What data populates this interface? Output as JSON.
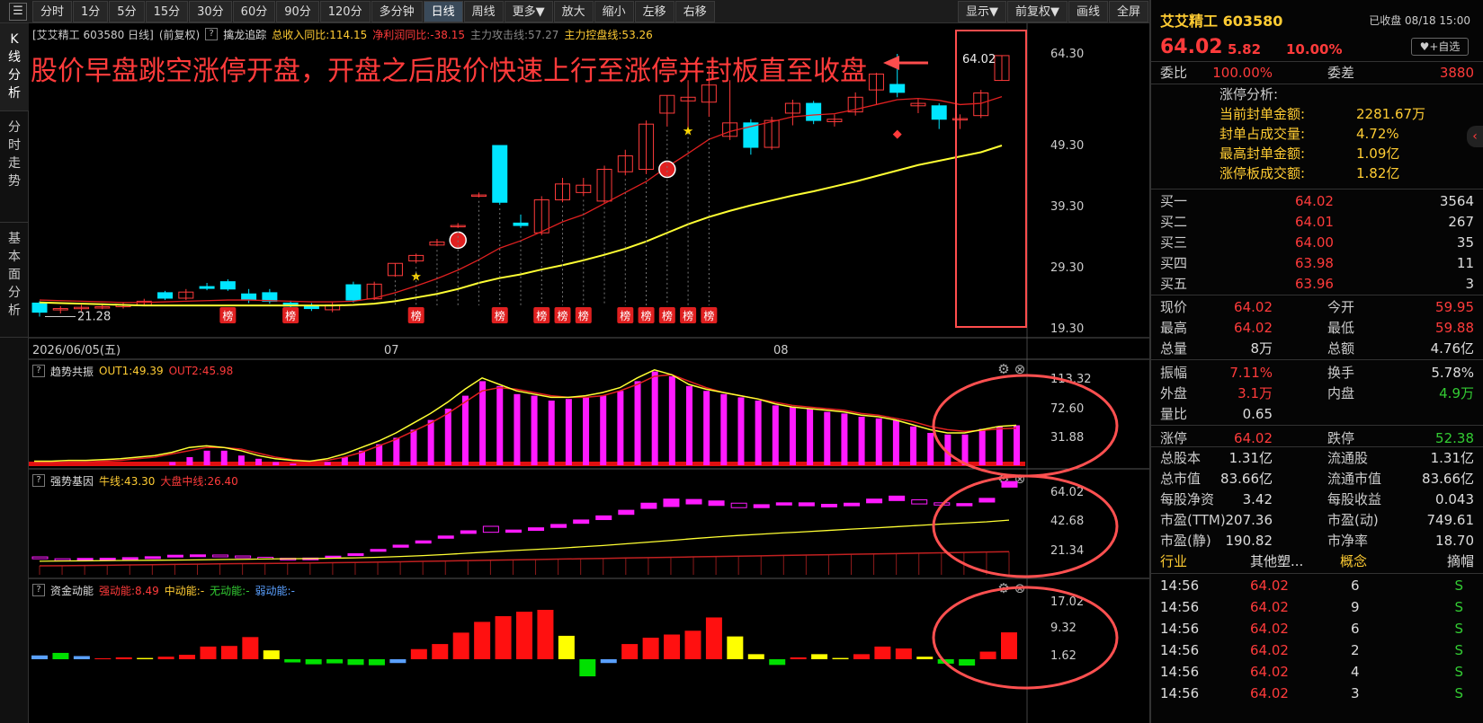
{
  "toolbar": {
    "items": [
      "分时",
      "1分",
      "5分",
      "15分",
      "30分",
      "60分",
      "90分",
      "120分",
      "多分钟",
      "日线",
      "周线",
      "更多▼",
      "放大",
      "缩小",
      "左移",
      "右移"
    ],
    "active": "日线",
    "right_items": [
      "显示▼",
      "前复权▼",
      "画线",
      "全屏"
    ]
  },
  "sidetabs": [
    "K线分析",
    "分时走势",
    "基本面分析"
  ],
  "main_info": {
    "name": "[艾艾精工 603580 日线]",
    "adjust": "(前复权)",
    "indicator": "擒龙追踪",
    "rev": "总收入同比:114.15",
    "profit": "净利润同比:-38.15",
    "attack": "主力攻击线:57.27",
    "control": "主力控盘线:53.26"
  },
  "annotation": "股价早盘跳空涨停开盘，开盘之后股价快速上行至涨停并封板直至收盘",
  "axis": {
    "main": [
      "64.30",
      "49.30",
      "39.30",
      "29.30",
      "19.30"
    ],
    "ind1": [
      "113.32",
      "72.60",
      "31.88"
    ],
    "ind2": [
      "64.02",
      "42.68",
      "21.34"
    ],
    "ind3": [
      "17.02",
      "9.32",
      "1.62"
    ],
    "dates": [
      "2026/06/05(五)",
      "07",
      "08"
    ],
    "low_label": "21.28",
    "last_label": "64.02"
  },
  "ind1": {
    "name": "趋势共振",
    "out1": "OUT1:49.39",
    "out2": "OUT2:45.98"
  },
  "ind2": {
    "name": "强势基因",
    "bull": "牛线:43.30",
    "market": "大盘中线:26.40"
  },
  "ind3": {
    "name": "资金动能",
    "strong": "强动能:8.49",
    "mid": "中动能:-",
    "none": "无动能:-",
    "weak": "弱动能:-"
  },
  "badge": "榜",
  "chart_data": {
    "type": "candlestick",
    "candles": [
      {
        "o": 23.5,
        "c": 22.0,
        "h": 23.8,
        "l": 21.28
      },
      {
        "o": 22.4,
        "c": 22.6,
        "h": 23.0,
        "l": 21.8
      },
      {
        "o": 22.6,
        "c": 22.8,
        "h": 23.2,
        "l": 22.2
      },
      {
        "o": 22.8,
        "c": 22.9,
        "h": 23.3,
        "l": 22.5
      },
      {
        "o": 22.9,
        "c": 23.2,
        "h": 23.6,
        "l": 22.6
      },
      {
        "o": 23.2,
        "c": 23.8,
        "h": 24.2,
        "l": 23.0
      },
      {
        "o": 25.2,
        "c": 24.3,
        "h": 25.5,
        "l": 24.0
      },
      {
        "o": 24.3,
        "c": 25.3,
        "h": 25.8,
        "l": 24.0
      },
      {
        "o": 26.2,
        "c": 25.9,
        "h": 26.8,
        "l": 25.6
      },
      {
        "o": 27.0,
        "c": 25.8,
        "h": 27.4,
        "l": 25.5
      },
      {
        "o": 25.0,
        "c": 24.0,
        "h": 25.8,
        "l": 23.5
      },
      {
        "o": 25.2,
        "c": 23.8,
        "h": 25.8,
        "l": 23.4
      },
      {
        "o": 23.5,
        "c": 23.0,
        "h": 23.9,
        "l": 22.6
      },
      {
        "o": 23.0,
        "c": 22.6,
        "h": 23.5,
        "l": 22.2
      },
      {
        "o": 22.4,
        "c": 23.2,
        "h": 23.6,
        "l": 22.0
      },
      {
        "o": 26.5,
        "c": 24.0,
        "h": 27.0,
        "l": 23.6
      },
      {
        "o": 24.2,
        "c": 26.6,
        "h": 27.0,
        "l": 24.0
      },
      {
        "o": 28.0,
        "c": 30.0,
        "h": 30.0,
        "l": 27.8
      },
      {
        "o": 30.4,
        "c": 31.3,
        "h": 31.6,
        "l": 30.0
      },
      {
        "o": 33.0,
        "c": 33.5,
        "h": 34.0,
        "l": 32.8
      },
      {
        "o": 36.0,
        "c": 36.2,
        "h": 36.6,
        "l": 35.8
      },
      {
        "o": 41.0,
        "c": 41.2,
        "h": 41.6,
        "l": 40.8
      },
      {
        "o": 49.3,
        "c": 40.0,
        "h": 49.3,
        "l": 39.6
      },
      {
        "o": 36.6,
        "c": 36.2,
        "h": 38.0,
        "l": 35.8
      },
      {
        "o": 35.0,
        "c": 40.4,
        "h": 41.0,
        "l": 34.6
      },
      {
        "o": 40.4,
        "c": 43.0,
        "h": 44.0,
        "l": 40.0
      },
      {
        "o": 41.6,
        "c": 42.8,
        "h": 44.0,
        "l": 41.0
      },
      {
        "o": 40.2,
        "c": 45.4,
        "h": 46.0,
        "l": 39.8
      },
      {
        "o": 45.0,
        "c": 47.6,
        "h": 48.6,
        "l": 44.4
      },
      {
        "o": 45.4,
        "c": 52.8,
        "h": 53.4,
        "l": 44.6
      },
      {
        "o": 54.6,
        "c": 57.5,
        "h": 57.5,
        "l": 52.4
      },
      {
        "o": 56.6,
        "c": 57.2,
        "h": 60.0,
        "l": 52.0
      },
      {
        "o": 56.4,
        "c": 59.2,
        "h": 62.0,
        "l": 54.0
      },
      {
        "o": 50.8,
        "c": 53.0,
        "h": 60.0,
        "l": 50.2
      },
      {
        "o": 53.0,
        "c": 49.0,
        "h": 53.6,
        "l": 47.8
      },
      {
        "o": 49.0,
        "c": 53.4,
        "h": 54.0,
        "l": 48.6
      },
      {
        "o": 54.6,
        "c": 56.2,
        "h": 56.8,
        "l": 52.6
      },
      {
        "o": 56.2,
        "c": 53.4,
        "h": 56.6,
        "l": 52.8
      },
      {
        "o": 53.2,
        "c": 53.6,
        "h": 54.4,
        "l": 52.4
      },
      {
        "o": 54.8,
        "c": 57.2,
        "h": 58.0,
        "l": 54.2
      },
      {
        "o": 58.4,
        "c": 61.0,
        "h": 61.2,
        "l": 56.0
      },
      {
        "o": 59.3,
        "c": 58.0,
        "h": 64.3,
        "l": 57.2
      },
      {
        "o": 55.8,
        "c": 56.2,
        "h": 57.0,
        "l": 54.6
      },
      {
        "o": 55.8,
        "c": 53.6,
        "h": 56.2,
        "l": 52.0
      },
      {
        "o": 53.5,
        "c": 53.7,
        "h": 54.4,
        "l": 52.0
      },
      {
        "o": 54.2,
        "c": 57.9,
        "h": 58.4,
        "l": 53.8
      },
      {
        "o": 59.95,
        "c": 64.02,
        "h": 64.02,
        "l": 59.88
      }
    ],
    "ma_red": [
      24.0,
      23.9,
      23.8,
      23.7,
      23.6,
      23.6,
      23.7,
      23.8,
      23.9,
      24.0,
      24.0,
      23.9,
      23.8,
      23.7,
      23.7,
      23.8,
      24.3,
      25.2,
      26.3,
      27.5,
      28.9,
      30.6,
      32.5,
      33.7,
      35.2,
      36.8,
      38.0,
      39.8,
      41.6,
      43.4,
      45.8,
      48.0,
      50.3,
      51.6,
      52.4,
      53.2,
      54.0,
      54.3,
      54.5,
      55.2,
      56.0,
      56.8,
      57.0,
      56.7,
      56.0,
      56.2,
      57.3
    ],
    "ma_yellow": [
      23.6,
      23.5,
      23.4,
      23.3,
      23.2,
      23.1,
      23.1,
      23.1,
      23.1,
      23.1,
      23.1,
      23.1,
      23.1,
      23.1,
      23.1,
      23.2,
      23.4,
      23.8,
      24.4,
      25.0,
      25.8,
      26.8,
      27.6,
      28.2,
      29.0,
      29.7,
      30.5,
      31.4,
      32.4,
      33.6,
      35.0,
      36.4,
      37.6,
      38.6,
      39.5,
      40.3,
      41.1,
      41.8,
      42.6,
      43.4,
      44.3,
      45.2,
      46.1,
      46.8,
      47.5,
      48.2,
      49.3
    ],
    "ind1_bars": [
      0,
      0,
      0,
      0,
      0,
      0,
      0,
      0,
      4,
      10,
      18,
      18,
      12,
      8,
      4,
      2,
      0,
      4,
      10,
      18,
      26,
      34,
      44,
      56,
      70,
      86,
      104,
      98,
      88,
      86,
      80,
      82,
      84,
      86,
      92,
      104,
      116,
      110,
      98,
      92,
      88,
      84,
      80,
      74,
      72,
      70,
      66,
      64,
      60,
      58,
      56,
      48,
      40,
      38,
      38,
      45,
      48,
      49.39
    ],
    "ind1_out1": [
      5,
      5,
      6,
      6,
      7,
      8,
      10,
      12,
      16,
      22,
      24,
      22,
      18,
      12,
      8,
      6,
      5,
      8,
      14,
      22,
      30,
      40,
      52,
      64,
      78,
      94,
      108,
      100,
      92,
      88,
      84,
      84,
      86,
      90,
      96,
      108,
      118,
      112,
      100,
      94,
      90,
      86,
      82,
      76,
      72,
      70,
      68,
      66,
      62,
      60,
      56,
      50,
      44,
      40,
      40,
      44,
      48,
      49.39
    ],
    "ind1_out2": [
      3,
      3,
      4,
      4,
      5,
      6,
      8,
      10,
      14,
      18,
      22,
      22,
      20,
      15,
      10,
      7,
      5,
      6,
      10,
      16,
      24,
      32,
      42,
      52,
      64,
      78,
      92,
      96,
      94,
      90,
      86,
      84,
      84,
      86,
      92,
      100,
      110,
      112,
      104,
      96,
      90,
      86,
      82,
      78,
      74,
      72,
      70,
      68,
      64,
      62,
      58,
      54,
      48,
      44,
      42,
      43,
      45,
      45.98
    ],
    "ind2_boxes": [
      {
        "o": 22.6,
        "c": 23.6,
        "u": 0
      },
      {
        "o": 22.0,
        "c": 22.6,
        "u": 0
      },
      {
        "o": 22.3,
        "c": 22.8,
        "u": 1
      },
      {
        "o": 22.5,
        "c": 22.9,
        "u": 1
      },
      {
        "o": 22.6,
        "c": 23.2,
        "u": 1
      },
      {
        "o": 22.9,
        "c": 23.7,
        "u": 1
      },
      {
        "o": 23.8,
        "c": 24.5,
        "u": 1
      },
      {
        "o": 24.1,
        "c": 24.7,
        "u": 1
      },
      {
        "o": 23.9,
        "c": 24.6,
        "u": 0
      },
      {
        "o": 23.2,
        "c": 24.1,
        "u": 0
      },
      {
        "o": 22.7,
        "c": 23.4,
        "u": 0
      },
      {
        "o": 22.3,
        "c": 22.9,
        "u": 0
      },
      {
        "o": 22.3,
        "c": 23.0,
        "u": 1
      },
      {
        "o": 23.2,
        "c": 24.0,
        "u": 1
      },
      {
        "o": 24.4,
        "c": 25.3,
        "u": 1
      },
      {
        "o": 26.6,
        "c": 27.6,
        "u": 1
      },
      {
        "o": 28.8,
        "c": 29.9,
        "u": 1
      },
      {
        "o": 31.0,
        "c": 32.2,
        "u": 1
      },
      {
        "o": 33.6,
        "c": 34.8,
        "u": 1
      },
      {
        "o": 36.2,
        "c": 37.6,
        "u": 1
      },
      {
        "o": 36.8,
        "c": 40.0,
        "u": 0
      },
      {
        "o": 36.8,
        "c": 38.0,
        "u": 1
      },
      {
        "o": 37.8,
        "c": 39.2,
        "u": 1
      },
      {
        "o": 39.4,
        "c": 41.0,
        "u": 1
      },
      {
        "o": 41.6,
        "c": 43.4,
        "u": 1
      },
      {
        "o": 43.6,
        "c": 45.6,
        "u": 1
      },
      {
        "o": 46.4,
        "c": 48.6,
        "u": 1
      },
      {
        "o": 49.6,
        "c": 52.4,
        "u": 1
      },
      {
        "o": 50.6,
        "c": 54.6,
        "u": 1
      },
      {
        "o": 52.0,
        "c": 54.4,
        "u": 1
      },
      {
        "o": 51.2,
        "c": 53.6,
        "u": 1
      },
      {
        "o": 50.0,
        "c": 52.4,
        "u": 0
      },
      {
        "o": 50.0,
        "c": 51.6,
        "u": 1
      },
      {
        "o": 51.4,
        "c": 52.6,
        "u": 1
      },
      {
        "o": 51.0,
        "c": 52.6,
        "u": 1
      },
      {
        "o": 50.4,
        "c": 51.8,
        "u": 1
      },
      {
        "o": 51.0,
        "c": 52.4,
        "u": 1
      },
      {
        "o": 52.6,
        "c": 54.6,
        "u": 1
      },
      {
        "o": 53.8,
        "c": 56.2,
        "u": 1
      },
      {
        "o": 52.0,
        "c": 54.2,
        "u": 0
      },
      {
        "o": 51.4,
        "c": 52.6,
        "u": 0
      },
      {
        "o": 51.0,
        "c": 52.2,
        "u": 1
      },
      {
        "o": 53.0,
        "c": 55.0,
        "u": 1
      },
      {
        "o": 61.0,
        "c": 64.02,
        "u": 1
      }
    ],
    "ind2_bull": [
      21.3,
      21.4,
      21.5,
      21.6,
      21.7,
      21.8,
      21.9,
      22.0,
      22.2,
      22.3,
      22.5,
      22.6,
      22.7,
      22.9,
      23.1,
      23.4,
      23.8,
      24.3,
      24.9,
      25.6,
      26.3,
      27.0,
      27.6,
      28.2,
      29.0,
      29.7,
      30.6,
      31.5,
      32.4,
      33.4,
      34.3,
      35.1,
      35.8,
      36.5,
      37.1,
      37.8,
      38.5,
      39.1,
      39.8,
      40.5,
      41.2,
      41.8,
      42.4,
      43.3
    ],
    "ind2_market": [
      18.8,
      18.9,
      19.0,
      19.1,
      19.3,
      19.4,
      19.6,
      19.7,
      19.9,
      20.0,
      20.1,
      20.2,
      20.3,
      20.5,
      20.6,
      20.8,
      21.0,
      21.2,
      21.4,
      21.6,
      21.8,
      22.0,
      22.2,
      22.4,
      22.6,
      22.8,
      23.0,
      23.2,
      23.4,
      23.6,
      23.8,
      24.0,
      24.2,
      24.4,
      24.6,
      24.8,
      25.0,
      25.2,
      25.4,
      25.6,
      25.8,
      26.0,
      26.2,
      26.4
    ],
    "ind3_bars": [
      {
        "v": 1.2,
        "t": "weak"
      },
      {
        "v": 2.0,
        "t": "none"
      },
      {
        "v": 1.0,
        "t": "weak"
      },
      {
        "v": 0.3,
        "t": "strong"
      },
      {
        "v": 0.6,
        "t": "strong"
      },
      {
        "v": 0.4,
        "t": "mid"
      },
      {
        "v": 0.8,
        "t": "strong"
      },
      {
        "v": 1.4,
        "t": "strong"
      },
      {
        "v": 4.0,
        "t": "strong"
      },
      {
        "v": 4.2,
        "t": "strong"
      },
      {
        "v": 7.0,
        "t": "strong"
      },
      {
        "v": 2.8,
        "t": "mid"
      },
      {
        "v": -1.0,
        "t": "none"
      },
      {
        "v": -1.6,
        "t": "none"
      },
      {
        "v": -1.3,
        "t": "none"
      },
      {
        "v": -1.8,
        "t": "none"
      },
      {
        "v": -1.9,
        "t": "none"
      },
      {
        "v": -1.2,
        "t": "weak"
      },
      {
        "v": 3.2,
        "t": "strong"
      },
      {
        "v": 4.8,
        "t": "strong"
      },
      {
        "v": 8.4,
        "t": "strong"
      },
      {
        "v": 11.8,
        "t": "strong"
      },
      {
        "v": 13.6,
        "t": "strong"
      },
      {
        "v": 15.0,
        "t": "strong"
      },
      {
        "v": 15.6,
        "t": "strong"
      },
      {
        "v": 7.4,
        "t": "mid"
      },
      {
        "v": -5.4,
        "t": "none"
      },
      {
        "v": -1.2,
        "t": "weak"
      },
      {
        "v": 4.8,
        "t": "strong"
      },
      {
        "v": 6.8,
        "t": "strong"
      },
      {
        "v": 7.8,
        "t": "strong"
      },
      {
        "v": 9.0,
        "t": "strong"
      },
      {
        "v": 13.2,
        "t": "strong"
      },
      {
        "v": 7.2,
        "t": "mid"
      },
      {
        "v": 1.6,
        "t": "mid"
      },
      {
        "v": -1.8,
        "t": "none"
      },
      {
        "v": 0.6,
        "t": "strong"
      },
      {
        "v": 1.6,
        "t": "mid"
      },
      {
        "v": 0.4,
        "t": "mid"
      },
      {
        "v": 1.6,
        "t": "strong"
      },
      {
        "v": 4.0,
        "t": "strong"
      },
      {
        "v": 3.4,
        "t": "strong"
      },
      {
        "v": 0.8,
        "t": "mid"
      },
      {
        "v": -1.4,
        "t": "none"
      },
      {
        "v": -2.0,
        "t": "none"
      },
      {
        "v": 2.4,
        "t": "strong"
      },
      {
        "v": 8.49,
        "t": "strong"
      }
    ]
  },
  "right": {
    "title": "艾艾精工 603580",
    "time": "已收盘 08/18 15:00",
    "price": "64.02",
    "chg": "5.82",
    "pct": "10.00%",
    "fav": "♥+自选",
    "weibi_l": "委比",
    "weibi": "100.00%",
    "weicha_l": "委差",
    "weicha": "3880",
    "zt_title": "涨停分析:",
    "zt": [
      [
        "当前封单金额:",
        "2281.67万"
      ],
      [
        "封单占成交量:",
        "4.72%"
      ],
      [
        "最高封单金额:",
        "1.09亿"
      ],
      [
        "涨停板成交额:",
        "1.82亿"
      ]
    ],
    "buy": [
      [
        "买一",
        "64.02",
        "3564"
      ],
      [
        "买二",
        "64.01",
        "267"
      ],
      [
        "买三",
        "64.00",
        "35"
      ],
      [
        "买四",
        "63.98",
        "11"
      ],
      [
        "买五",
        "63.96",
        "3"
      ]
    ],
    "quote": [
      [
        "现价",
        "64.02",
        "今开",
        "59.95"
      ],
      [
        "最高",
        "64.02",
        "最低",
        "59.88"
      ],
      [
        "总量",
        "8万",
        "总额",
        "4.76亿"
      ],
      [
        "振幅",
        "7.11%",
        "换手",
        "5.78%"
      ],
      [
        "外盘",
        "3.1万",
        "内盘",
        "4.9万"
      ],
      [
        "量比",
        "0.65",
        "",
        ""
      ],
      [
        "涨停",
        "64.02",
        "跌停",
        "52.38"
      ]
    ],
    "fund": [
      [
        "总股本",
        "1.31亿",
        "流通股",
        "1.31亿"
      ],
      [
        "总市值",
        "83.66亿",
        "流通市值",
        "83.66亿"
      ],
      [
        "每股净资",
        "3.42",
        "每股收益",
        "0.043"
      ],
      [
        "市盈(TTM)",
        "207.36",
        "市盈(动)",
        "749.61"
      ],
      [
        "市盈(静)",
        "190.82",
        "市净率",
        "18.70"
      ]
    ],
    "fund_header": [
      "行业",
      "其他塑...",
      "概念",
      "摘帽"
    ],
    "ticks": [
      [
        "14:56",
        "64.02",
        "6",
        "S"
      ],
      [
        "14:56",
        "64.02",
        "9",
        "S"
      ],
      [
        "14:56",
        "64.02",
        "6",
        "S"
      ],
      [
        "14:56",
        "64.02",
        "2",
        "S"
      ],
      [
        "14:56",
        "64.02",
        "4",
        "S"
      ],
      [
        "14:56",
        "64.02",
        "3",
        "S"
      ]
    ],
    "colors": {
      "up": "#ff3b3b",
      "down": "#33cc33",
      "label": "#ffcc33"
    }
  }
}
